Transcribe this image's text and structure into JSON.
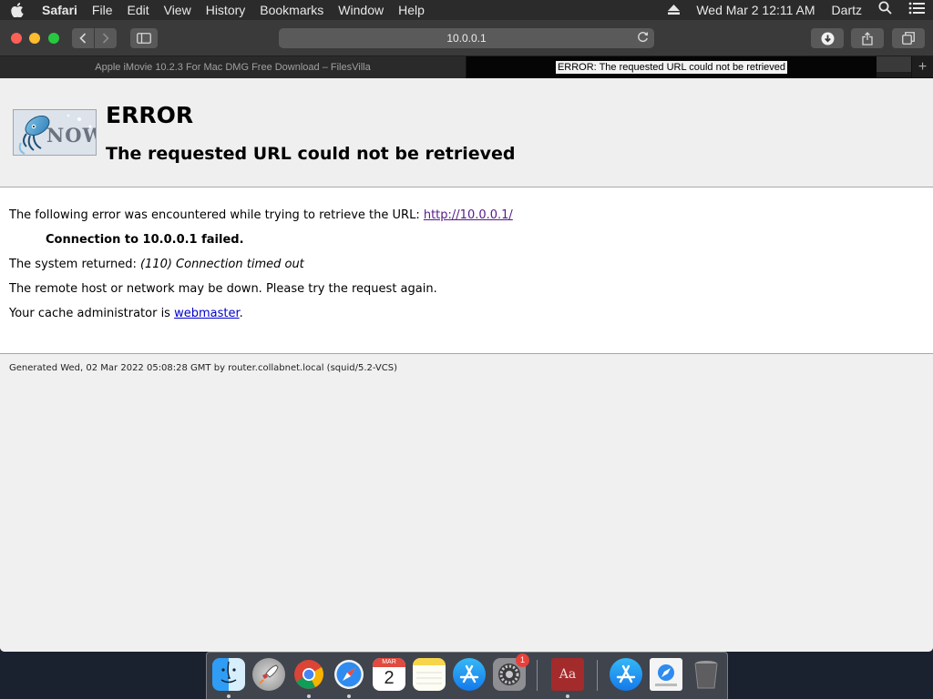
{
  "menubar": {
    "app": "Safari",
    "items": [
      "File",
      "Edit",
      "View",
      "History",
      "Bookmarks",
      "Window",
      "Help"
    ],
    "clock": "Wed Mar 2  12:11 AM",
    "user": "Dartz"
  },
  "toolbar": {
    "address": "10.0.0.1"
  },
  "tabs": [
    {
      "title": "Apple iMovie 10.2.3 For Mac DMG Free Download – FilesVilla"
    },
    {
      "title": "ERROR: The requested URL could not be retrieved"
    }
  ],
  "page": {
    "title": "ERROR",
    "subtitle": "The requested URL could not be retrieved",
    "logo_text": "NOW",
    "error_intro": "The following error was encountered while trying to retrieve the URL: ",
    "url": "http://10.0.0.1/",
    "error_detail": "Connection to 10.0.0.1 failed.",
    "system_returned_label": "The system returned: ",
    "system_returned_value": "(110) Connection timed out",
    "remote_msg": "The remote host or network may be down. Please try the request again.",
    "admin_text": "Your cache administrator is ",
    "admin_link": "webmaster",
    "admin_end": ".",
    "footer": "Generated Wed, 02 Mar 2022 05:08:28 GMT by router.collabnet.local (squid/5.2-VCS)"
  },
  "dock": {
    "calendar_month": "MAR",
    "calendar_day": "2",
    "settings_badge": "1",
    "dictionary_label": "Aa"
  },
  "colors": {
    "link_visited": "#551a8b",
    "link": "#0000cc",
    "menubar_bg": "#2b2b2b",
    "toolbar_bg": "#3a3a3a"
  }
}
